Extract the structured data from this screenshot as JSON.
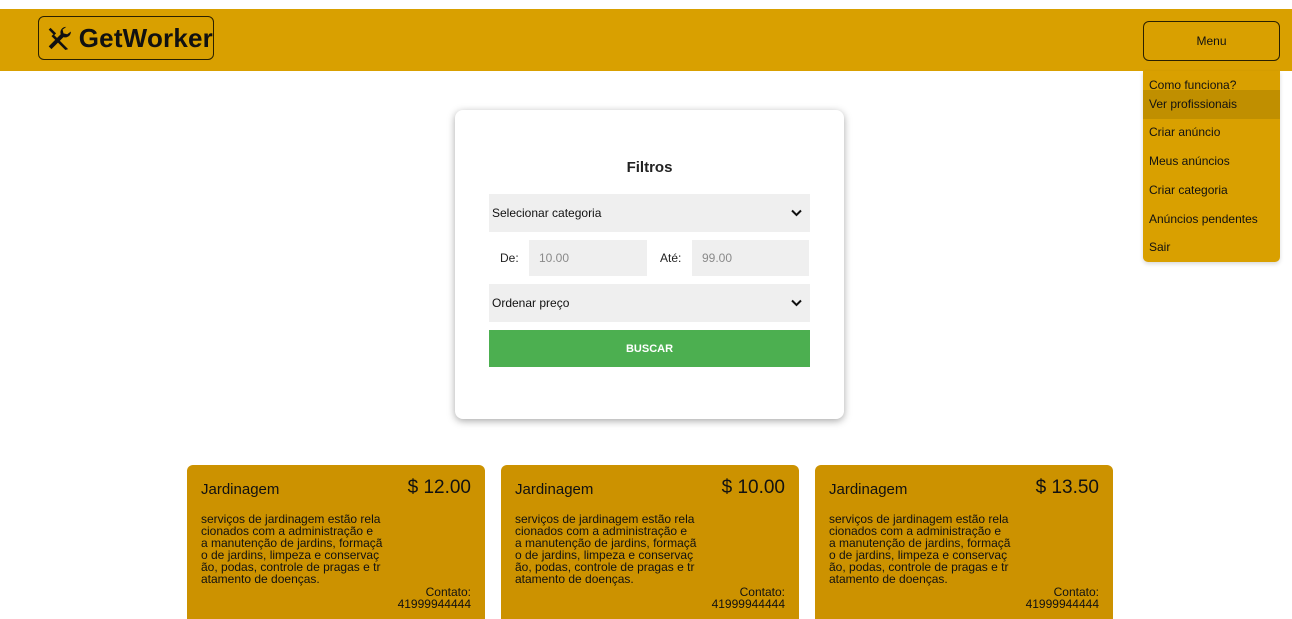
{
  "brand": {
    "name": "GetWorker",
    "color": "#d9a000"
  },
  "menu": {
    "button_label": "Menu",
    "items": [
      {
        "label": "Como funciona?",
        "active": false
      },
      {
        "label": "Ver profissionais",
        "active": true
      },
      {
        "label": "Criar anúncio",
        "active": false
      },
      {
        "label": "Meus anúncios",
        "active": false
      },
      {
        "label": "Criar categoria",
        "active": false
      },
      {
        "label": "Anúncios pendentes",
        "active": false
      },
      {
        "label": "Sair",
        "active": false
      }
    ]
  },
  "filters": {
    "title": "Filtros",
    "category_select": "Selecionar categoria",
    "from_label": "De:",
    "from_placeholder": "10.00",
    "to_label": "Até:",
    "to_placeholder": "99.00",
    "order_select": "Ordenar preço",
    "search_label": "BUSCAR",
    "search_color": "#4caf50"
  },
  "ads": [
    {
      "title": "Jardinagem",
      "price": "$ 12.00",
      "description": "serviços de jardinagem estão relacionados com a administração e a manutenção de jardins, formação de jardins, limpeza e conservação, podas, controle de pragas e tratamento de doenças.",
      "contact_label": "Contato:",
      "contact": "41999944444"
    },
    {
      "title": "Jardinagem",
      "price": "$ 10.00",
      "description": "serviços de jardinagem estão relacionados com a administração e a manutenção de jardins, formação de jardins, limpeza e conservação, podas, controle de pragas e tratamento de doenças.",
      "contact_label": "Contato:",
      "contact": "41999944444"
    },
    {
      "title": "Jardinagem",
      "price": "$ 13.50",
      "description": "serviços de jardinagem estão relacionados com a administração e a manutenção de jardins, formação de jardins, limpeza e conservação, podas, controle de pragas e tratamento de doenças.",
      "contact_label": "Contato:",
      "contact": "41999944444"
    }
  ],
  "icons": {
    "logo": "tools-icon",
    "dropdown": "chevron-down-icon"
  }
}
